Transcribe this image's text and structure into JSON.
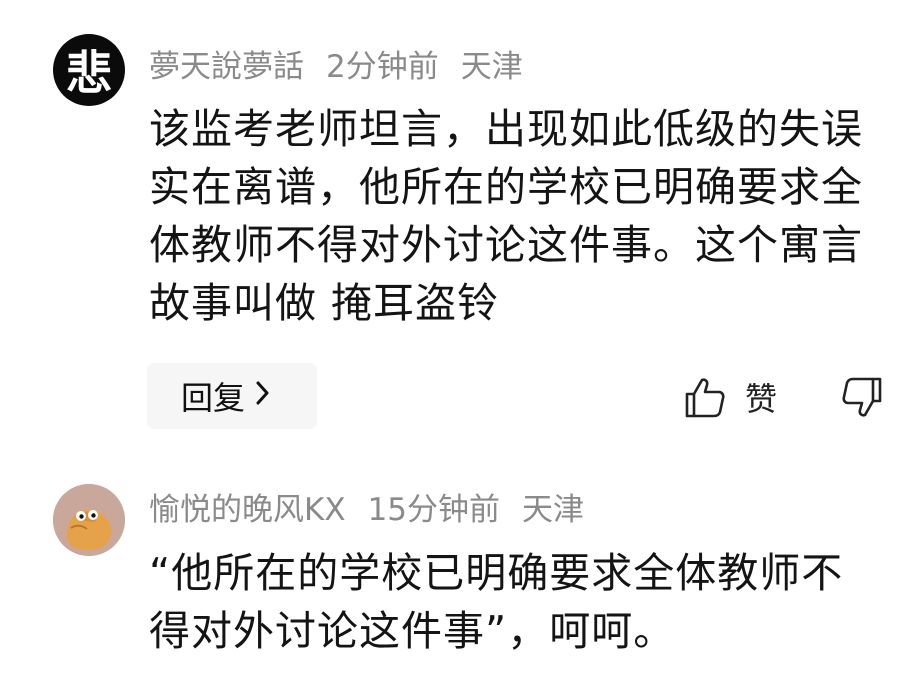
{
  "comments": [
    {
      "avatar_char": "悲",
      "username": "夢天說夢話",
      "time": "2分钟前",
      "location": "天津",
      "text": "该监考老师坦言，出现如此低级的失误实在离谱，他所在的学校已明确要求全体教师不得对外讨论这件事。这个寓言故事叫做 掩耳盗铃",
      "reply_label": "回复",
      "like_label": "赞"
    },
    {
      "username": "愉悦的晚风KX",
      "time": "15分钟前",
      "location": "天津",
      "text": "“他所在的学校已明确要求全体教师不得对外讨论这件事”，呵呵。"
    }
  ],
  "icons": {
    "reply_chevron": "chevron-right-icon",
    "like": "thumbs-up-icon",
    "dislike": "thumbs-down-icon"
  },
  "colors": {
    "meta_text": "#8a8a8a",
    "body_text": "#141414",
    "reply_bg": "#f6f6f6",
    "avatar1_bg": "#0b0b0b",
    "avatar2_bg": "#c9a89b"
  }
}
